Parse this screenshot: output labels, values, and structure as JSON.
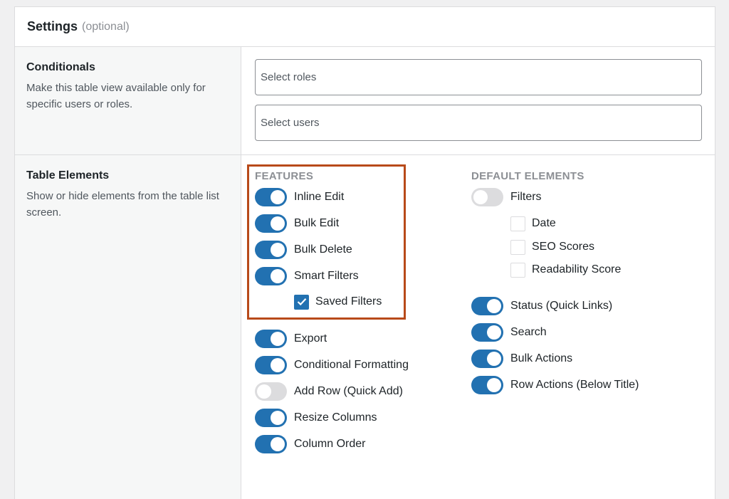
{
  "header": {
    "title": "Settings",
    "subtitle": "(optional)"
  },
  "conditionals": {
    "title": "Conditionals",
    "description": "Make this table view available only for specific users or roles.",
    "roles_placeholder": "Select roles",
    "users_placeholder": "Select users"
  },
  "table_elements": {
    "title": "Table Elements",
    "description": "Show or hide elements from the table list screen.",
    "features": {
      "heading": "FEATURES",
      "items": [
        {
          "label": "Inline Edit",
          "on": true
        },
        {
          "label": "Bulk Edit",
          "on": true
        },
        {
          "label": "Bulk Delete",
          "on": true
        },
        {
          "label": "Smart Filters",
          "on": true
        }
      ],
      "saved_filters": {
        "label": "Saved Filters",
        "checked": true
      },
      "more_items": [
        {
          "label": "Export",
          "on": true
        },
        {
          "label": "Conditional Formatting",
          "on": true
        },
        {
          "label": "Add Row (Quick Add)",
          "on": false
        },
        {
          "label": "Resize Columns",
          "on": true
        },
        {
          "label": "Column Order",
          "on": true
        }
      ]
    },
    "default_elements": {
      "heading": "DEFAULT ELEMENTS",
      "filters": {
        "label": "Filters",
        "on": false
      },
      "filter_options": [
        {
          "label": "Date",
          "checked": false
        },
        {
          "label": "SEO Scores",
          "checked": false
        },
        {
          "label": "Readability Score",
          "checked": false
        }
      ],
      "items": [
        {
          "label": "Status (Quick Links)",
          "on": true
        },
        {
          "label": "Search",
          "on": true
        },
        {
          "label": "Bulk Actions",
          "on": true
        },
        {
          "label": "Row Actions (Below Title)",
          "on": true
        }
      ]
    }
  },
  "colors": {
    "accent": "#2271b1",
    "highlight": "#b84a1a",
    "toggle_off": "#dcdcde"
  }
}
